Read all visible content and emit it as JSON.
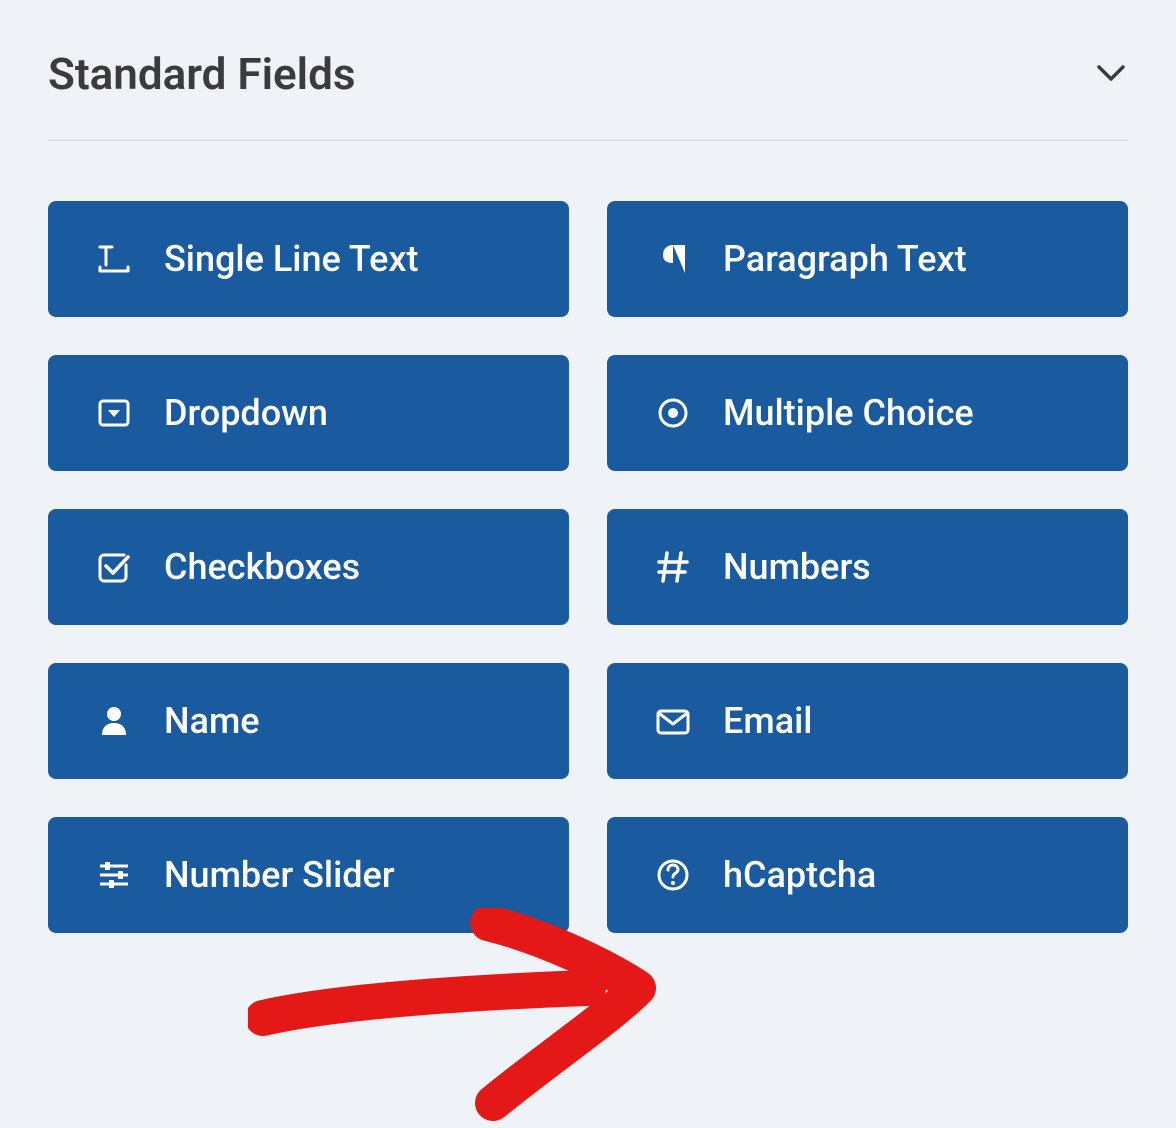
{
  "section": {
    "title": "Standard Fields"
  },
  "fields": [
    {
      "label": "Single Line Text",
      "icon": "text-input-icon",
      "name": "field-single-line-text"
    },
    {
      "label": "Paragraph Text",
      "icon": "paragraph-icon",
      "name": "field-paragraph-text"
    },
    {
      "label": "Dropdown",
      "icon": "dropdown-icon",
      "name": "field-dropdown"
    },
    {
      "label": "Multiple Choice",
      "icon": "radio-icon",
      "name": "field-multiple-choice"
    },
    {
      "label": "Checkboxes",
      "icon": "checkbox-icon",
      "name": "field-checkboxes"
    },
    {
      "label": "Numbers",
      "icon": "hash-icon",
      "name": "field-numbers"
    },
    {
      "label": "Name",
      "icon": "user-icon",
      "name": "field-name"
    },
    {
      "label": "Email",
      "icon": "envelope-icon",
      "name": "field-email"
    },
    {
      "label": "Number Slider",
      "icon": "sliders-icon",
      "name": "field-number-slider"
    },
    {
      "label": "hCaptcha",
      "icon": "question-circle-icon",
      "name": "field-hcaptcha"
    }
  ],
  "colors": {
    "button": "#1a5a9e",
    "background": "#eff3f7",
    "title": "#3b3b3b",
    "annotation": "#e51818"
  }
}
